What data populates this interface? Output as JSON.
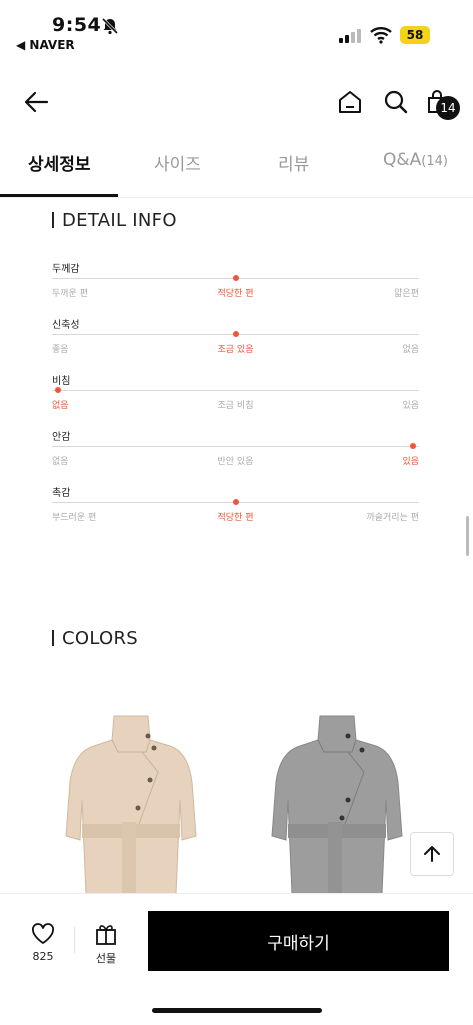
{
  "status": {
    "time": "9:54",
    "back_app": "◀ NAVER",
    "battery": "58"
  },
  "nav": {
    "cart_count": "14"
  },
  "tabs": [
    {
      "label": "상세정보",
      "active": true
    },
    {
      "label": "사이즈",
      "active": false
    },
    {
      "label": "리뷰",
      "active": false
    },
    {
      "label": "Q&A",
      "count": "(14)",
      "active": false
    }
  ],
  "detail_info": {
    "title": "DETAIL INFO",
    "rows": [
      {
        "label": "두께감",
        "options": [
          "두꺼운 편",
          "적당한 편",
          "얇은편"
        ],
        "selected": 1
      },
      {
        "label": "신축성",
        "options": [
          "좋음",
          "조금 있음",
          "없음"
        ],
        "selected": 1
      },
      {
        "label": "비침",
        "options": [
          "없음",
          "조금 비침",
          "있음"
        ],
        "selected": 0
      },
      {
        "label": "안감",
        "options": [
          "없음",
          "반안 있음",
          "있음"
        ],
        "selected": 2
      },
      {
        "label": "촉감",
        "options": [
          "부드러운 편",
          "적당한 편",
          "까슬거리는 편"
        ],
        "selected": 1
      }
    ]
  },
  "colors": {
    "title": "COLORS",
    "items": [
      {
        "name": "beige-coat",
        "color": "#e6d2bd",
        "shade": "#d4bea7"
      },
      {
        "name": "gray-coat",
        "color": "#9d9d9d",
        "shade": "#888888"
      }
    ]
  },
  "bottom": {
    "like_count": "825",
    "gift_label": "선물",
    "buy_label": "구매하기"
  },
  "accent": "#f0553a"
}
